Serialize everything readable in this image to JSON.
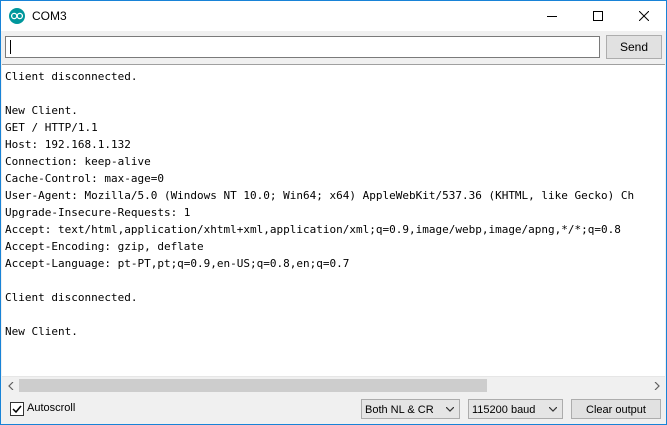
{
  "window": {
    "title": "COM3",
    "icon": "arduino-logo-icon"
  },
  "input": {
    "value": "",
    "send_label": "Send"
  },
  "output": {
    "lines": [
      "Client disconnected.",
      "",
      "New Client.",
      "GET / HTTP/1.1",
      "Host: 192.168.1.132",
      "Connection: keep-alive",
      "Cache-Control: max-age=0",
      "User-Agent: Mozilla/5.0 (Windows NT 10.0; Win64; x64) AppleWebKit/537.36 (KHTML, like Gecko) Ch",
      "Upgrade-Insecure-Requests: 1",
      "Accept: text/html,application/xhtml+xml,application/xml;q=0.9,image/webp,image/apng,*/*;q=0.8",
      "Accept-Encoding: gzip, deflate",
      "Accept-Language: pt-PT,pt;q=0.9,en-US;q=0.8,en;q=0.7",
      "",
      "Client disconnected.",
      "",
      "New Client."
    ]
  },
  "bottom": {
    "autoscroll_label": "Autoscroll",
    "autoscroll_checked": true,
    "line_ending": "Both NL & CR",
    "baud": "115200 baud",
    "clear_label": "Clear output"
  },
  "colors": {
    "window_border": "#1883d7",
    "icon": "#00979c"
  }
}
